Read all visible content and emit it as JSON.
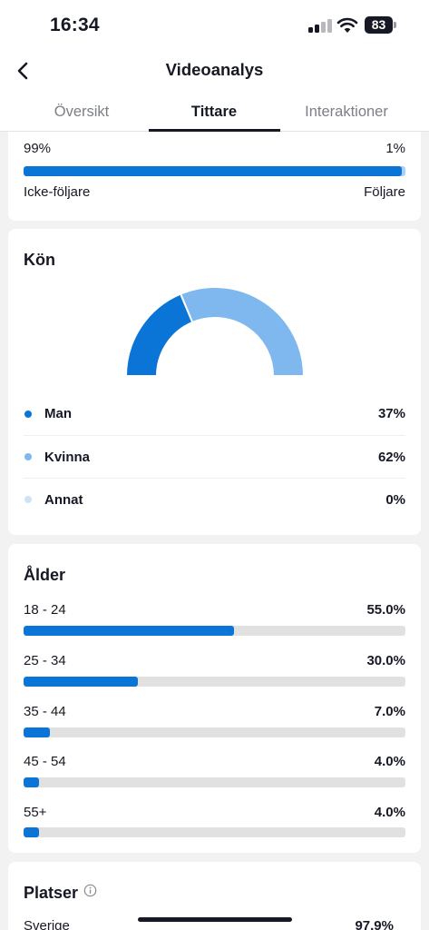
{
  "status_bar": {
    "time": "16:34",
    "battery_level": "83",
    "icons": [
      "signal-icon",
      "wifi-icon",
      "battery-icon"
    ]
  },
  "nav": {
    "title": "Videoanalys",
    "back_icon": "chevron-left-icon"
  },
  "tabs": [
    {
      "label": "Översikt",
      "active": false
    },
    {
      "label": "Tittare",
      "active": true
    },
    {
      "label": "Interaktioner",
      "active": false
    }
  ],
  "followers": {
    "left_pct": "99%",
    "right_pct": "1%",
    "left_label": "Icke-följare",
    "right_label": "Följare",
    "non_follower_fraction": 0.99
  },
  "gender": {
    "title": "Kön",
    "items": [
      {
        "label": "Man",
        "pct": "37%",
        "value": 37,
        "color": "#0a75d6"
      },
      {
        "label": "Kvinna",
        "pct": "62%",
        "value": 62,
        "color": "#7fb8ee"
      },
      {
        "label": "Annat",
        "pct": "0%",
        "value": 0,
        "color": "#cfe3f6"
      }
    ]
  },
  "age": {
    "title": "Ålder",
    "items": [
      {
        "label": "18 - 24",
        "pct": "55.0%",
        "value": 55.0
      },
      {
        "label": "25 - 34",
        "pct": "30.0%",
        "value": 30.0
      },
      {
        "label": "35 - 44",
        "pct": "7.0%",
        "value": 7.0
      },
      {
        "label": "45 - 54",
        "pct": "4.0%",
        "value": 4.0
      },
      {
        "label": "55+",
        "pct": "4.0%",
        "value": 4.0
      }
    ]
  },
  "places": {
    "title": "Platser",
    "info_icon": "info-icon",
    "items": [
      {
        "label": "Sverige",
        "pct": "97.9%"
      }
    ]
  },
  "colors": {
    "accent": "#0a75d6",
    "accent_light": "#7fb8ee",
    "track": "#e1e1e2"
  }
}
